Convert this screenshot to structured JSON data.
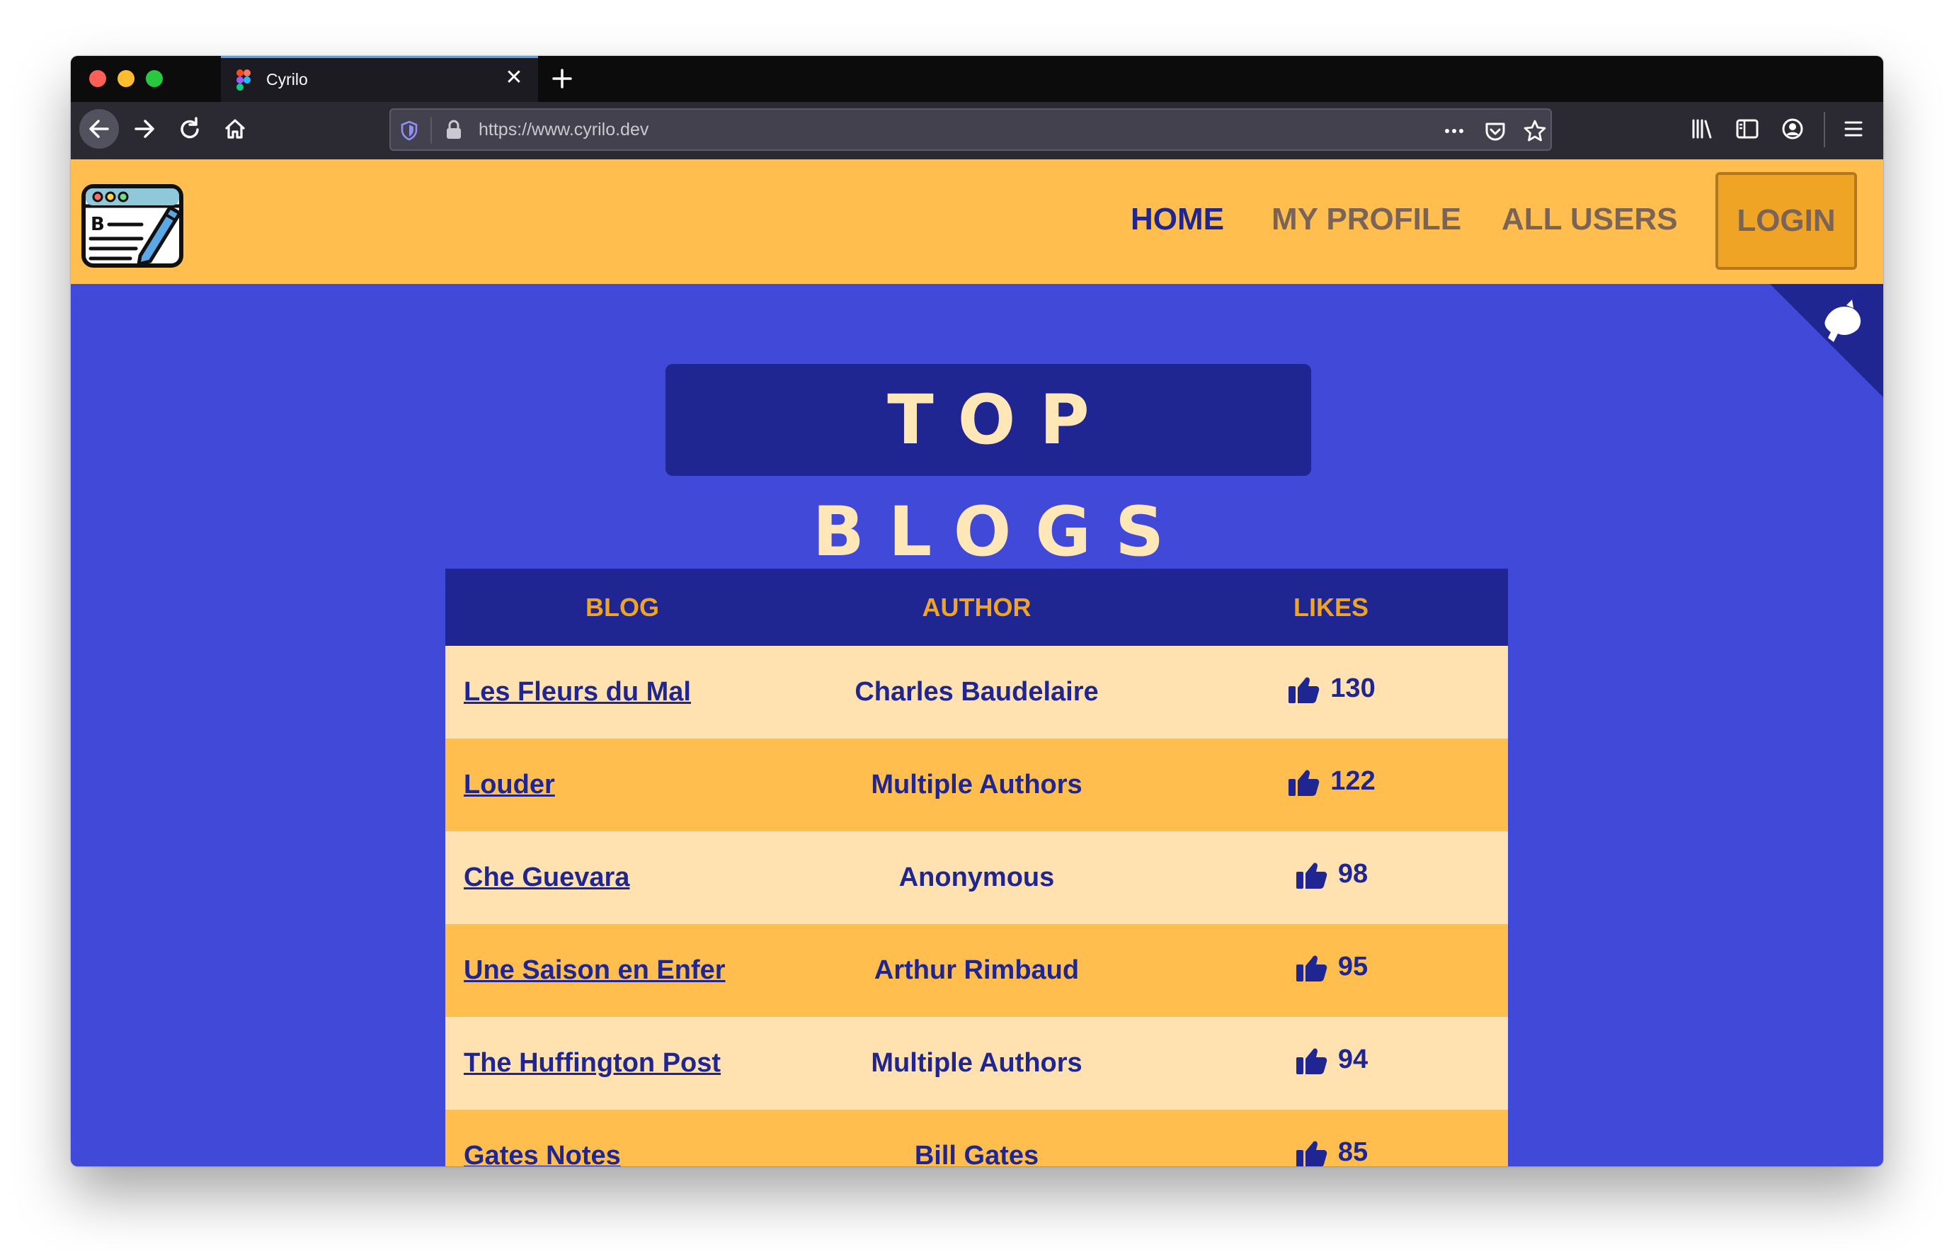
{
  "browser": {
    "tab_title": "Cyrilo",
    "url": "https://www.cyrilo.dev"
  },
  "site": {
    "nav": {
      "home": "HOME",
      "profile": "MY PROFILE",
      "users": "ALL USERS",
      "login": "LOGIN"
    },
    "title": "TOP BLOGS",
    "table": {
      "headers": {
        "blog": "BLOG",
        "author": "AUTHOR",
        "likes": "LIKES"
      },
      "rows": [
        {
          "blog": "Les Fleurs du Mal",
          "author": "Charles Baudelaire",
          "likes": "130"
        },
        {
          "blog": "Louder",
          "author": "Multiple Authors",
          "likes": "122"
        },
        {
          "blog": "Che Guevara",
          "author": "Anonymous",
          "likes": "98"
        },
        {
          "blog": "Une Saison en Enfer",
          "author": "Arthur Rimbaud",
          "likes": "95"
        },
        {
          "blog": "The Huffington Post",
          "author": "Multiple Authors",
          "likes": "94"
        },
        {
          "blog": "Gates Notes",
          "author": "Bill Gates",
          "likes": "85"
        }
      ]
    }
  },
  "colors": {
    "header_bg": "#ffbe4d",
    "page_bg": "#4149d8",
    "navy": "#1f2591",
    "row_light": "#ffe2b0",
    "row_dark": "#ffbe4d",
    "accent_orange": "#f0a425"
  },
  "icons": {
    "logo": "blog-logo-icon",
    "likes": "thumbs-up-icon",
    "corner": "bird-icon"
  }
}
